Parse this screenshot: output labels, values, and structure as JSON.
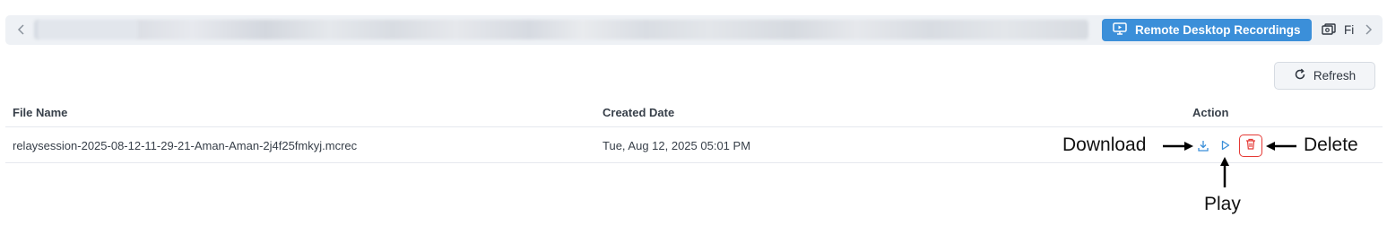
{
  "tabs": {
    "active_label": "Remote Desktop Recordings",
    "next_label": "Fi"
  },
  "toolbar": {
    "refresh_label": "Refresh"
  },
  "table": {
    "columns": [
      "File Name",
      "Created Date",
      "Action"
    ],
    "rows": [
      {
        "file_name": "relaysession-2025-08-12-11-29-21-Aman-Aman-2j4f25fmkyj.mcrec",
        "created_date": "Tue, Aug 12, 2025 05:01 PM"
      }
    ]
  },
  "annotations": {
    "download": "Download",
    "play": "Play",
    "delete": "Delete"
  },
  "icons": {
    "tab_prev": "chevron-left-icon",
    "tab_next": "chevron-right-icon",
    "active_tab": "monitor-play-icon",
    "next_tab": "files-icon",
    "refresh": "refresh-icon",
    "download": "download-icon",
    "play": "play-icon",
    "delete": "trash-icon"
  },
  "colors": {
    "accent": "#3b8fd9",
    "danger": "#e53935",
    "tabbar_bg": "#eef1f5"
  }
}
